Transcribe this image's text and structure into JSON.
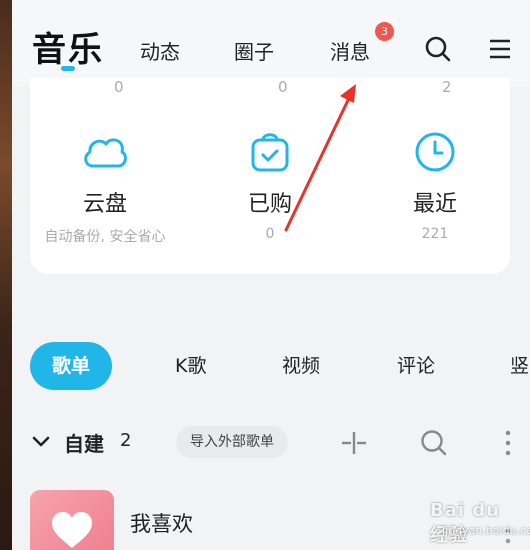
{
  "header": {
    "active_tab": "音乐",
    "tabs": [
      "动态",
      "圈子",
      "消息"
    ],
    "message_badge": "3",
    "search_icon": "search-icon",
    "menu_icon": "menu-icon"
  },
  "card": {
    "top_counts": [
      "0",
      "0",
      "2"
    ],
    "stats": [
      {
        "label": "云盘",
        "sub": "自动备份, 安全省心",
        "icon": "cloud-icon"
      },
      {
        "label": "已购",
        "sub": "0",
        "icon": "purchased-bag-icon"
      },
      {
        "label": "最近",
        "sub": "221",
        "icon": "clock-icon"
      }
    ]
  },
  "segments": [
    "歌单",
    "K歌",
    "视频",
    "评论",
    "竖"
  ],
  "section": {
    "title": "自建",
    "count": "2",
    "import_label": "导入外部歌单"
  },
  "playlist": {
    "name": "我喜欢"
  },
  "watermark": {
    "main": "Bai du 经验",
    "sub": "jingyan.baidu.com"
  },
  "colors": {
    "accent": "#21b6e8",
    "badge": "#f0574f",
    "annotation": "#e8322a"
  }
}
